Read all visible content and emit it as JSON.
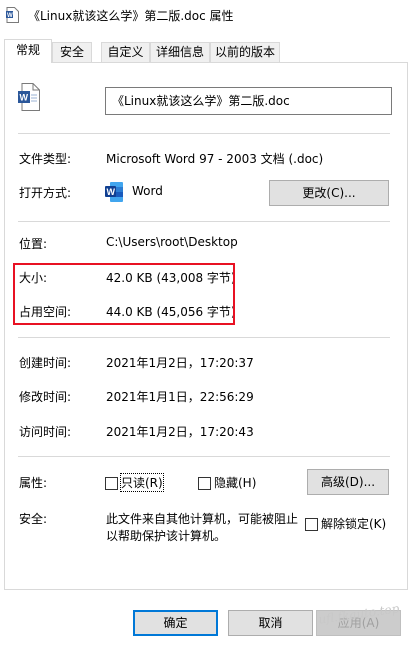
{
  "window": {
    "title": "《Linux就该这么学》第二版.doc 属性"
  },
  "tabs": [
    {
      "label": "常规",
      "active": true
    },
    {
      "label": "安全",
      "active": false
    },
    {
      "label": "自定义",
      "active": false
    },
    {
      "label": "详细信息",
      "active": false
    },
    {
      "label": "以前的版本",
      "active": false
    }
  ],
  "general": {
    "file_name": "《Linux就该这么学》第二版.doc",
    "file_type_label": "文件类型:",
    "file_type_value": "Microsoft Word 97 - 2003 文档 (.doc)",
    "open_with_label": "打开方式:",
    "open_with_value": "Word",
    "change_button": "更改(C)...",
    "location_label": "位置:",
    "location_value": "C:\\Users\\root\\Desktop",
    "size_label": "大小:",
    "size_value": "42.0 KB (43,008 字节)",
    "size_on_disk_label": "占用空间:",
    "size_on_disk_value": "44.0 KB (45,056 字节)",
    "created_label": "创建时间:",
    "created_value": "2021年1月2日，17:20:37",
    "modified_label": "修改时间:",
    "modified_value": "2021年1月1日，22:56:29",
    "accessed_label": "访问时间:",
    "accessed_value": "2021年1月2日，17:20:43",
    "attributes_label": "属性:",
    "readonly_label": "只读(R)",
    "readonly_checked": false,
    "hidden_label": "隐藏(H)",
    "hidden_checked": false,
    "advanced_button": "高级(D)...",
    "security_label": "安全:",
    "security_text_line1": "此文件来自其他计算机，可能被阻止",
    "security_text_line2": "以帮助保护该计算机。",
    "unblock_label": "解除锁定(K)",
    "unblock_checked": false
  },
  "footer": {
    "ok_button": "确定",
    "cancel_button": "取消",
    "apply_button": "应用(A)"
  },
  "watermark": "ufl.fkauto.top",
  "colors": {
    "highlight_border": "#e81123",
    "word_blue": "#2b579a",
    "default_button_border": "#0078d7"
  },
  "icons": {
    "title": "word-document-icon",
    "file": "word-document-icon",
    "open_with": "word-app-icon"
  }
}
